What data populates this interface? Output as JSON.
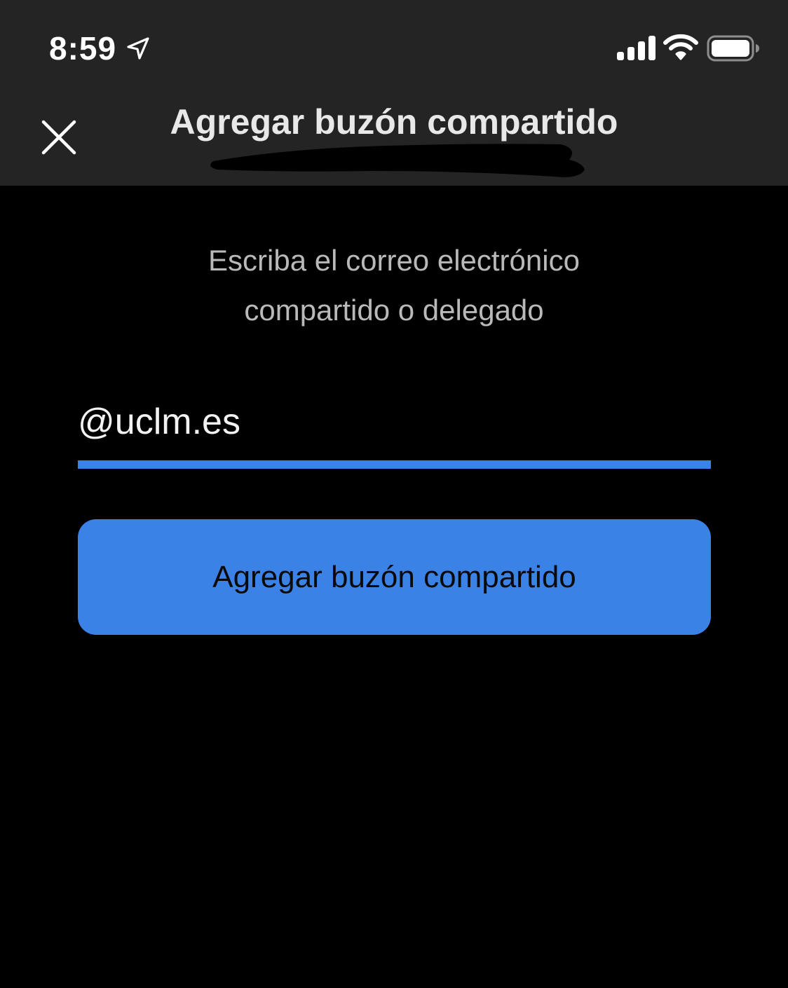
{
  "status_bar": {
    "time": "8:59",
    "icons": [
      "location-arrow-icon",
      "cellular-signal-icon",
      "wifi-icon",
      "battery-icon"
    ]
  },
  "header": {
    "title": "Agregar buzón compartido",
    "close_icon": "close-icon"
  },
  "main": {
    "instructions_line1": "Escriba el correo electrónico",
    "instructions_line2": "compartido o delegado",
    "email_value": "@uclm.es",
    "add_button_label": "Agregar buzón compartido"
  },
  "colors": {
    "accent": "#3b82e6",
    "header_bg": "#242424",
    "background": "#000000",
    "instructions_text": "#b9b9b9"
  }
}
